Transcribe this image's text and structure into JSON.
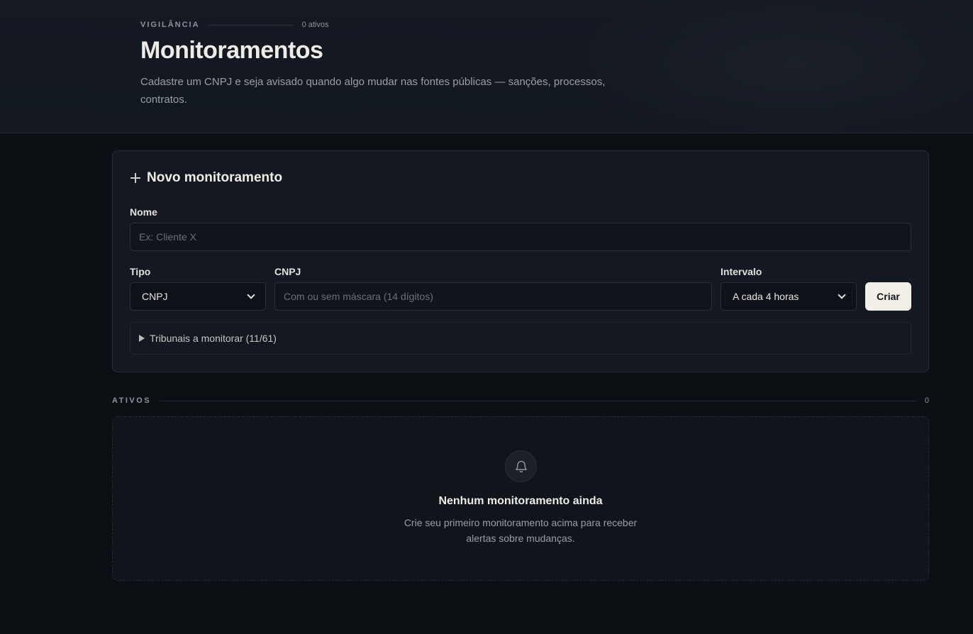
{
  "header": {
    "eyebrow": "VIGILÂNCIA",
    "active_count_label": "0 ativos",
    "title": "Monitoramentos",
    "subtitle": "Cadastre um CNPJ e seja avisado quando algo mudar nas fontes públicas — sanções, processos, contratos."
  },
  "form": {
    "title": "Novo monitoramento",
    "name_label": "Nome",
    "name_placeholder": "Ex: Cliente X",
    "name_value": "",
    "type_label": "Tipo",
    "type_value": "CNPJ",
    "cnpj_label": "CNPJ",
    "cnpj_placeholder": "Com ou sem máscara (14 dígitos)",
    "cnpj_value": "",
    "interval_label": "Intervalo",
    "interval_value": "A cada 4 horas",
    "submit_label": "Criar",
    "tribunais_label": "Tribunais a monitorar (11/61)"
  },
  "active_section": {
    "label": "ATIVOS",
    "count": "0",
    "empty_title": "Nenhum monitoramento ainda",
    "empty_subtitle": "Crie seu primeiro monitoramento acima para receber alertas sobre mudanças."
  },
  "icons": {
    "add": "plus-icon",
    "expand": "triangle-right-icon",
    "dropdown": "chevron-down-icon",
    "empty_state": "bell-icon"
  },
  "colors": {
    "background": "#0c0f14",
    "card": "#131821",
    "primary_button": "#f1efe6",
    "text": "#eeece6",
    "muted_text": "#9a9ea8"
  }
}
